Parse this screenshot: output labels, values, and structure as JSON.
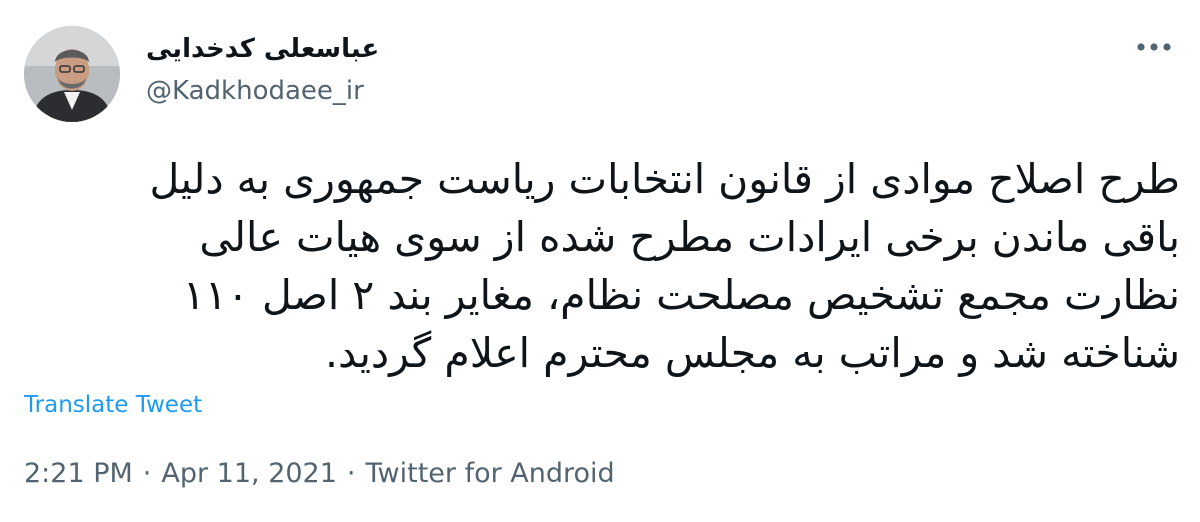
{
  "author": {
    "display_name": "عباسعلی کدخدایی",
    "handle": "@Kadkhodaee_ir"
  },
  "more_icon": "more-horizontal-icon",
  "tweet": {
    "lines": [
      "طرح اصلاح موادی از قانون انتخابات ریاست جمهوری به دلیل",
      "باقی ماندن برخی ایرادات مطرح شده از سوی هیات عالی",
      "نظارت مجمع تشخیص مصلحت نظام، مغایر بند ۲ اصل ۱۱۰",
      "شناخته شد و مراتب به مجلس محترم اعلام گردید."
    ],
    "translate_label": "Translate Tweet"
  },
  "meta": {
    "time": "2:21 PM",
    "separator": "·",
    "date": "Apr 11, 2021",
    "source": "Twitter for Android"
  },
  "colors": {
    "text_primary": "#0f1419",
    "text_secondary": "#536471",
    "link": "#1d9bf0"
  }
}
